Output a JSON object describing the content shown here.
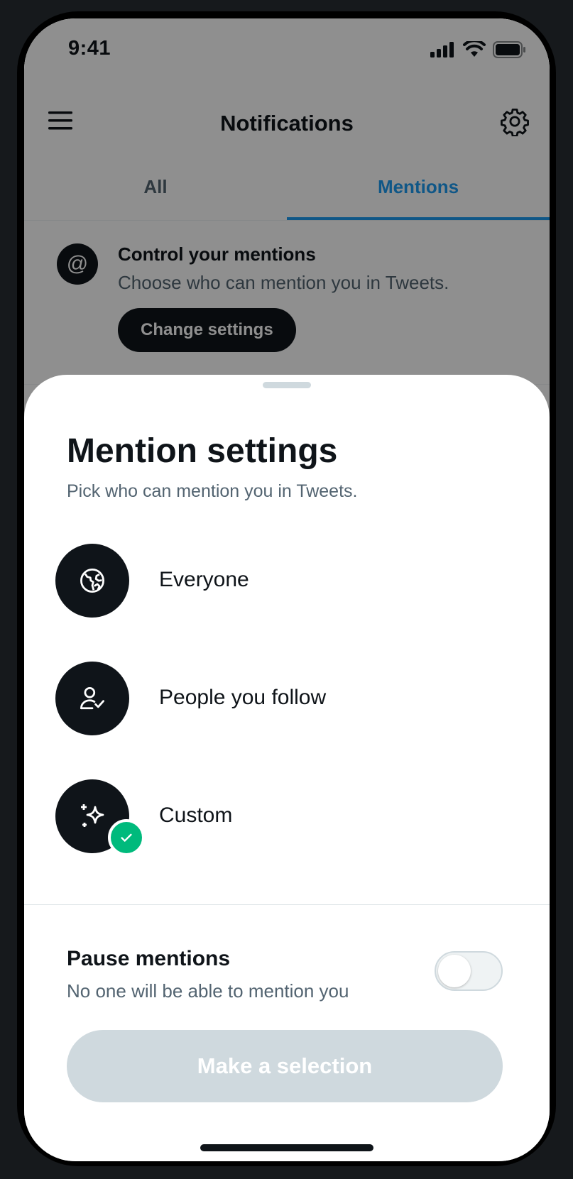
{
  "status_bar": {
    "time": "9:41"
  },
  "header": {
    "title": "Notifications"
  },
  "tabs": [
    {
      "label": "All",
      "active": false
    },
    {
      "label": "Mentions",
      "active": true
    }
  ],
  "promo": {
    "title": "Control your mentions",
    "subtitle": "Choose who can mention you in Tweets.",
    "button_label": "Change settings"
  },
  "sheet": {
    "title": "Mention settings",
    "subtitle": "Pick who can mention you in Tweets.",
    "options": [
      {
        "label": "Everyone",
        "icon": "globe-icon",
        "selected": false
      },
      {
        "label": "People you follow",
        "icon": "person-check-icon",
        "selected": false
      },
      {
        "label": "Custom",
        "icon": "sparkles-icon",
        "selected": true
      }
    ],
    "pause": {
      "title": "Pause mentions",
      "subtitle": "No one will be able to mention you",
      "enabled": false
    },
    "cta_label": "Make a selection"
  },
  "colors": {
    "accent": "#1d9bf0",
    "text_primary": "#0f1419",
    "text_secondary": "#536471",
    "success": "#00ba7c",
    "cta_disabled": "#cfd9de"
  }
}
